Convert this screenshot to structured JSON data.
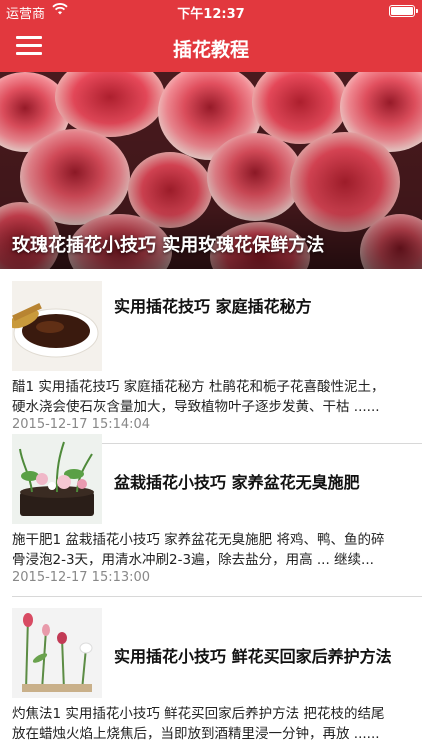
{
  "status_bar": {
    "carrier": "运营商",
    "time": "下午12:37"
  },
  "nav": {
    "title": "插花教程"
  },
  "hero": {
    "caption": "玫瑰花插花小技巧 实用玫瑰花保鲜方法"
  },
  "articles": [
    {
      "title": "实用插花技巧 家庭插花秘方",
      "summary_line1": "醋1 实用插花技巧 家庭插花秘方 杜鹃花和栀子花喜酸性泥土，",
      "summary_line2": "硬水浇会使石灰含量加大，导致植物叶子逐步发黄、干枯 ......",
      "date": "2015-12-17 15:14:04"
    },
    {
      "title": "盆栽插花小技巧 家养盆花无臭施肥",
      "summary_line1": "施干肥1 盆栽插花小技巧 家养盆花无臭施肥 将鸡、鸭、鱼的碎",
      "summary_line2": "骨浸泡2-3天，用清水冲刷2-3遍，除去盐分，用高 ... 继续...",
      "date": "2015-12-17 15:13:00"
    },
    {
      "title": "实用插花小技巧 鲜花买回家后养护方法",
      "summary_line1": "灼焦法1 实用插花小技巧 鲜花买回家后养护方法 把花枝的结尾",
      "summary_line2": "放在蜡烛火焰上烧焦后，当即放到酒精里浸一分钟，再放 ......",
      "date": ""
    }
  ],
  "colors": {
    "brand_red": "#e2383e",
    "date_gray": "#888888"
  },
  "icons": {
    "menu": "hamburger-menu-icon",
    "wifi": "wifi-icon",
    "battery": "battery-icon"
  }
}
